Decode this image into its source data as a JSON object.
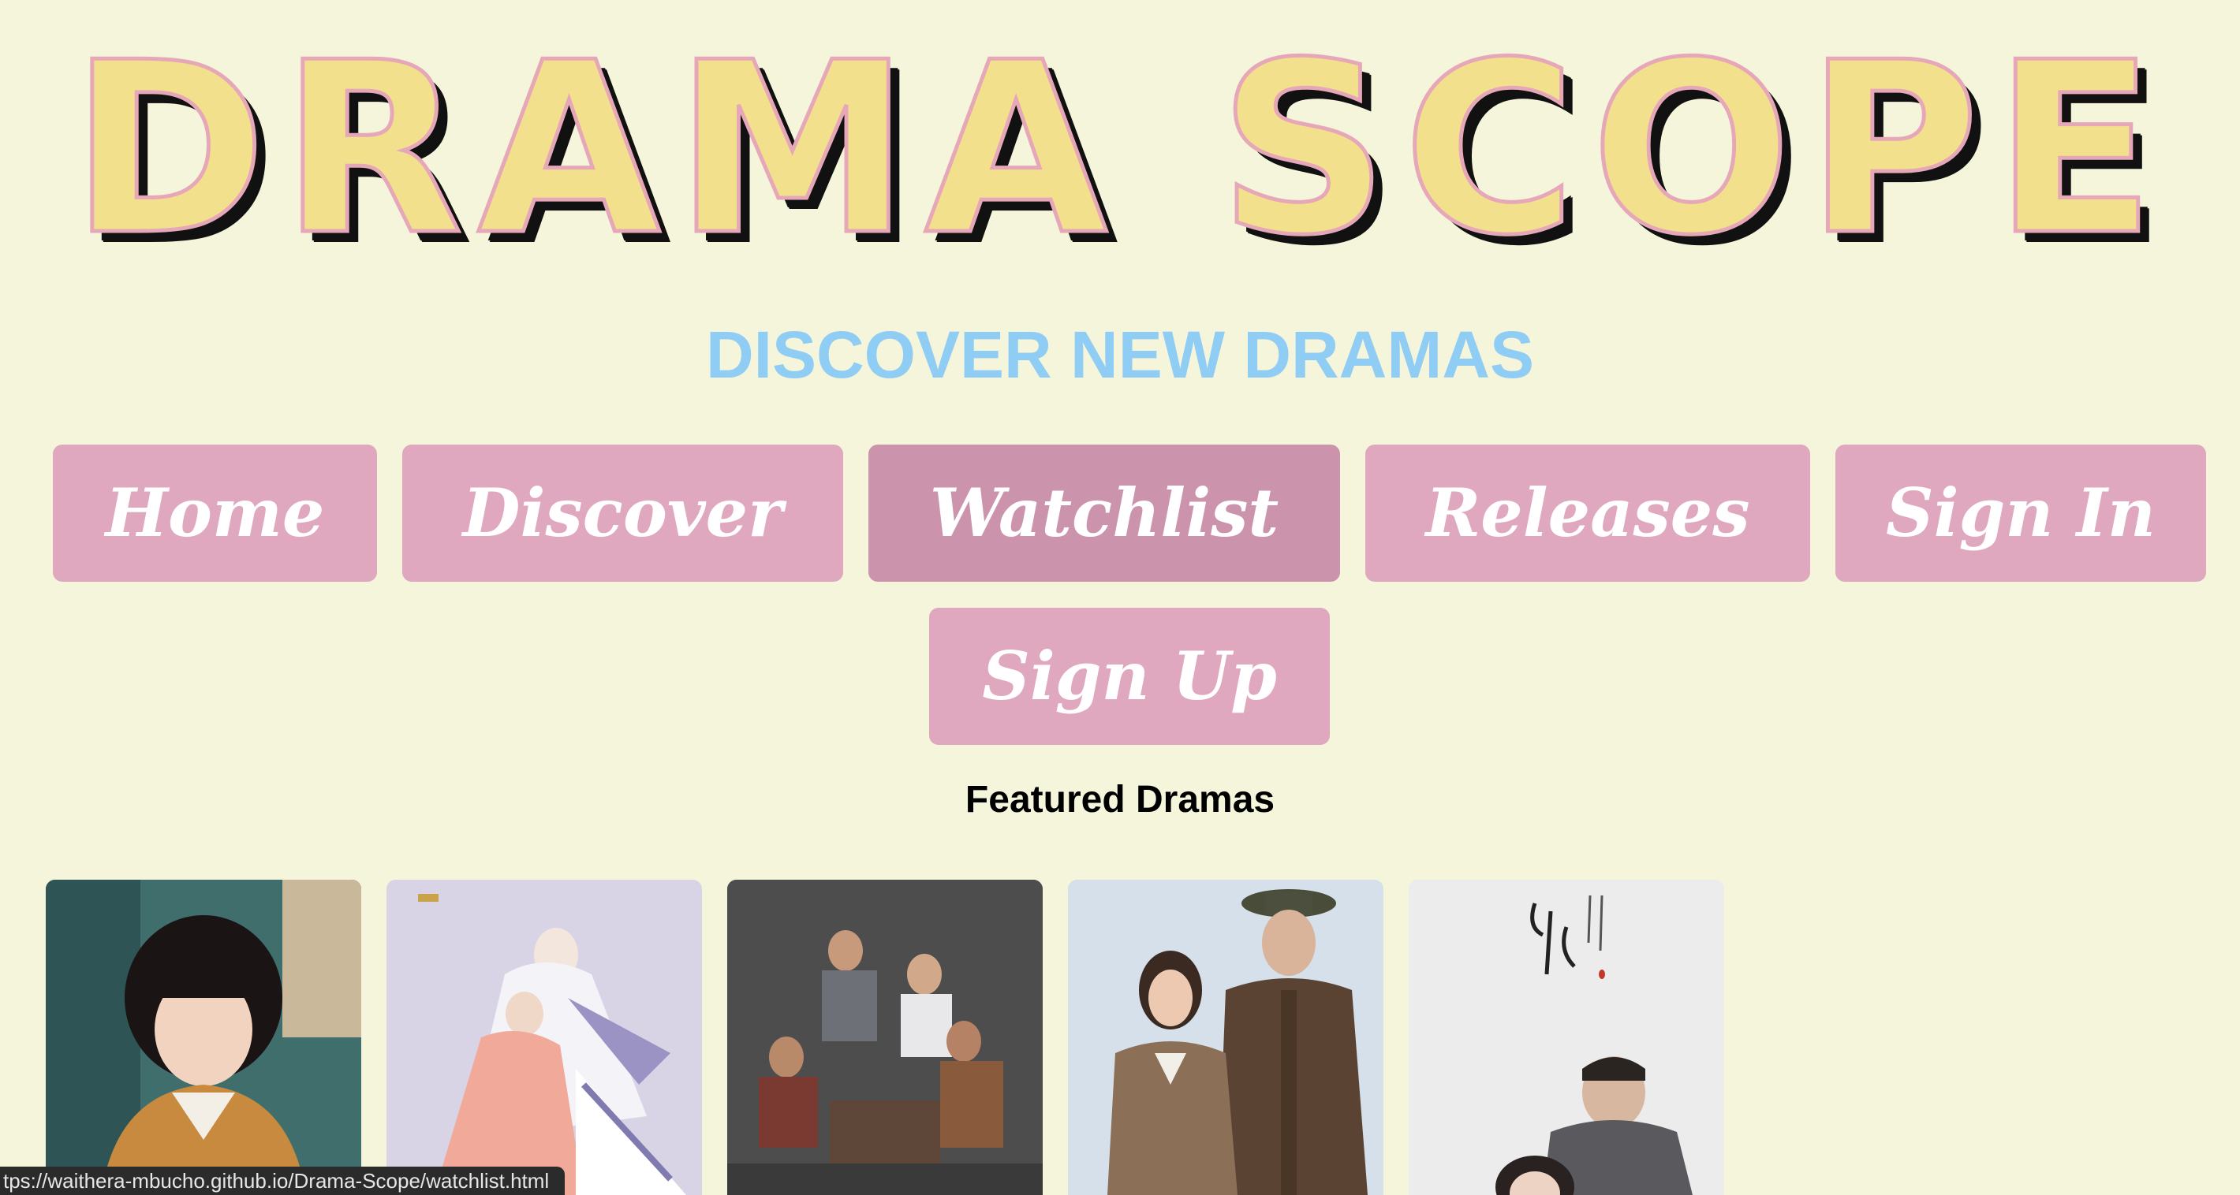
{
  "header": {
    "logo_text": "DRAMA SCOPE",
    "subtitle": "DISCOVER NEW DRAMAS"
  },
  "nav": {
    "items": [
      {
        "label": "Home"
      },
      {
        "label": "Discover"
      },
      {
        "label": "Watchlist"
      },
      {
        "label": "Releases"
      },
      {
        "label": "Sign In"
      },
      {
        "label": "Sign Up"
      }
    ],
    "hovered": "Watchlist"
  },
  "featured": {
    "title": "Featured Dramas",
    "posters": [
      {
        "icon": "poster-image"
      },
      {
        "icon": "poster-image"
      },
      {
        "icon": "poster-image"
      },
      {
        "icon": "poster-image"
      },
      {
        "icon": "poster-image"
      }
    ]
  },
  "status_bar": {
    "url": "tps://waithera-mbucho.github.io/Drama-Scope/watchlist.html"
  },
  "colors": {
    "background": "#f5f5dc",
    "nav_button": "#e0a8bf",
    "nav_button_hover": "#cc93ad",
    "subtitle": "#90cdf4",
    "logo_fill": "#f2e08c",
    "logo_outline": "#e6a8b8"
  }
}
